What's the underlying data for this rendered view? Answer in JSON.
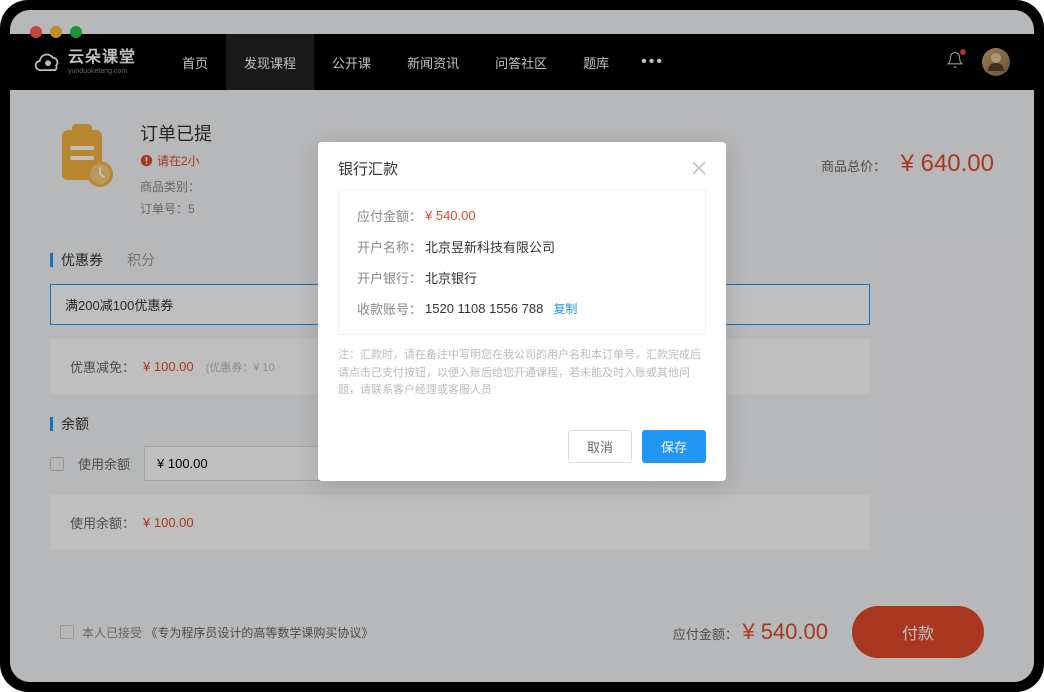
{
  "logo": {
    "main": "云朵课堂",
    "sub": "yunduoketang.com"
  },
  "nav": {
    "items": [
      "首页",
      "发现课程",
      "公开课",
      "新闻资讯",
      "问答社区",
      "题库"
    ],
    "active_index": 1
  },
  "order": {
    "title": "订单已提",
    "warning": "请在2小",
    "meta_category_label": "商品类别：",
    "meta_orderno_label": "订单号：5",
    "total_label": "商品总价：",
    "total_price": "¥ 640.00"
  },
  "coupon": {
    "tab_coupon": "优惠券",
    "tab_points": "积分",
    "select_value": "满200减100优惠券",
    "discount_label": "优惠减免：",
    "discount_amount": "¥ 100.00",
    "discount_hint": "(优惠券：¥ 10"
  },
  "balance": {
    "section_label": "余额",
    "use_balance_label": "使用余额",
    "input_value": "¥ 100.00",
    "used_label": "使用余额：",
    "used_amount": "¥ 100.00"
  },
  "footer": {
    "agree_prefix": "本人已接受",
    "agree_link": "《专为程序员设计的高等数学课购买协议》",
    "total_label": "应付金额：",
    "total_price": "¥ 540.00",
    "pay_button": "付款"
  },
  "modal": {
    "title": "银行汇款",
    "amount_label": "应付金额",
    "amount_value": "¥ 540.00",
    "account_name_label": "开户名称",
    "account_name_value": "北京昱新科技有限公司",
    "bank_label": "开户银行",
    "bank_value": "北京银行",
    "account_no_label": "收款账号",
    "account_no_value": "1520 1108 1556 788",
    "copy": "复制",
    "note_prefix": "注：",
    "note": "汇款时，请在备注中写明您在我公司的用户名和本订单号，汇款完成后请点击已支付按钮，以便入账后给您开通课程，若未能及时入账或其他问题，请联系客户经理或客服人员",
    "cancel": "取消",
    "save": "保存"
  }
}
